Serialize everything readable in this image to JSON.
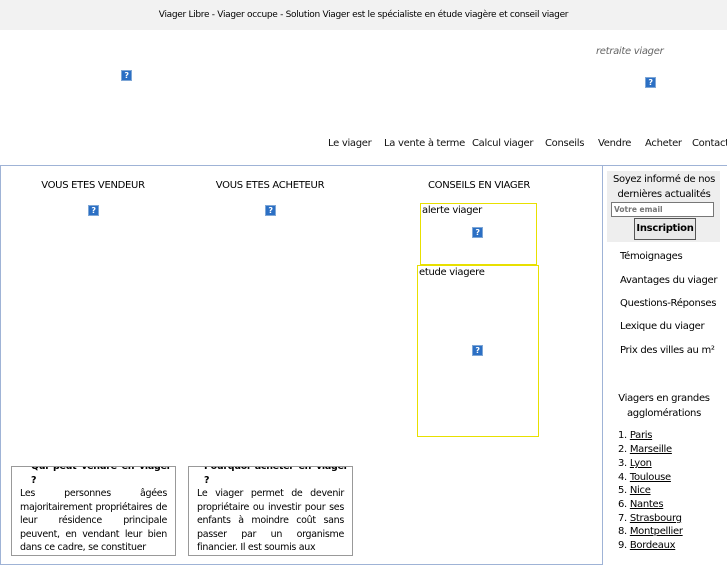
{
  "topbar": {
    "text": "Viager Libre - Viager occupe - Solution Viager est le spécialiste en étude viagère et conseil viager"
  },
  "header": {
    "tagline": "retraite viager",
    "broken_image_glyph": "?"
  },
  "nav": {
    "items": [
      "Le viager",
      "La vente à terme",
      "Calcul viager",
      "Conseils",
      "Vendre",
      "Acheter",
      "Contact"
    ]
  },
  "columns": {
    "vendeur": "VOUS ETES VENDEUR",
    "acheteur": "VOUS ETES ACHETEUR",
    "conseils": "CONSEILS EN VIAGER"
  },
  "boxes": {
    "alerte": "alerte viager",
    "etude": "etude viagere"
  },
  "fieldsets": {
    "vendre": {
      "legend": "Qui peut vendre en viager ?",
      "body": "Les personnes âgées majoritairement propriétaires de leur résidence principale peuvent, en vendant leur bien dans ce cadre, se constituer"
    },
    "acheter": {
      "legend": "Pourquoi acheter en viager ?",
      "body": "Le viager permet de devenir propriétaire ou investir pour ses enfants à moindre coût sans passer par un organisme financier. Il est soumis aux"
    }
  },
  "sidebar": {
    "newsletter_text": "Soyez informé de nos dernières actualités",
    "email_placeholder": "Votre email",
    "submit_label": "Inscription",
    "links": [
      "Témoignages",
      "Avantages du viager",
      "Questions-Réponses",
      "Lexique du viager",
      "Prix des villes au m²"
    ],
    "cities_title": "Viagers en grandes agglomérations",
    "cities": [
      {
        "num": "1.",
        "name": "Paris"
      },
      {
        "num": "2.",
        "name": "Marseille"
      },
      {
        "num": "3.",
        "name": "Lyon"
      },
      {
        "num": "4.",
        "name": "Toulouse"
      },
      {
        "num": "5.",
        "name": "Nice"
      },
      {
        "num": "6.",
        "name": "Nantes"
      },
      {
        "num": "7.",
        "name": "Strasbourg"
      },
      {
        "num": "8.",
        "name": "Montpellier"
      },
      {
        "num": "9.",
        "name": "Bordeaux"
      }
    ]
  }
}
